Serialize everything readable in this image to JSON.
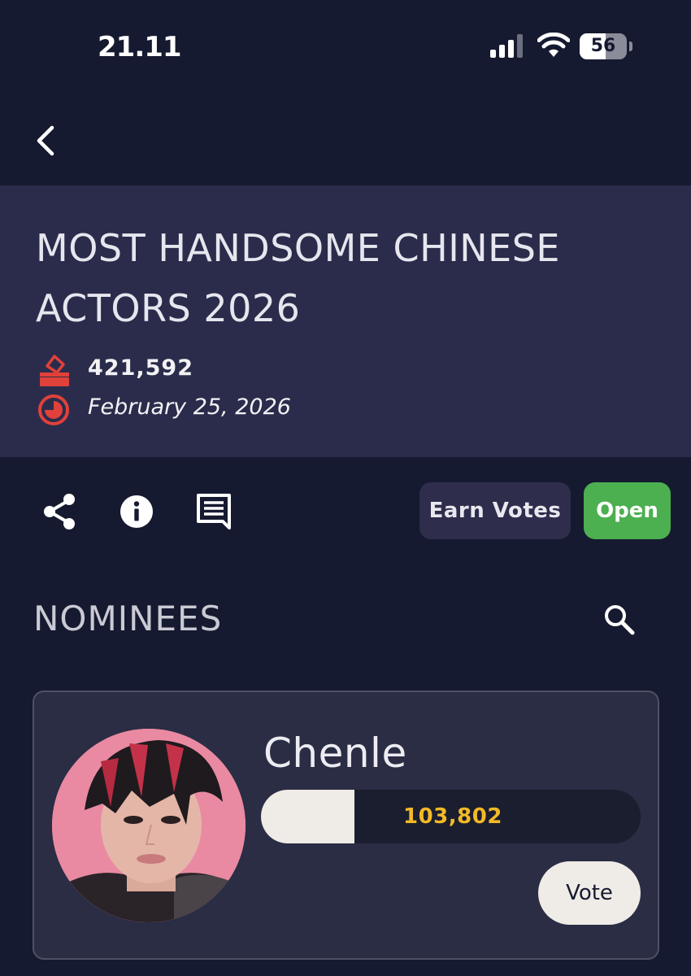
{
  "status_bar": {
    "time": "21.11",
    "battery_level": "56",
    "battery_fraction": 0.56
  },
  "header": {
    "title": "MOST HANDSOME CHINESE ACTORS 2026",
    "total_votes": "421,592",
    "end_date": "February 25, 2026"
  },
  "actions": {
    "earn_votes_label": "Earn Votes",
    "status_label": "Open"
  },
  "nominees": {
    "section_title": "NOMINEES",
    "items": [
      {
        "name": "Chenle",
        "votes": "103,802",
        "vote_share_fraction": 0.246,
        "vote_label": "Vote"
      }
    ]
  },
  "icons": {
    "back": "chevron-left-icon",
    "ballot": "ballot-box-icon",
    "clock": "clock-icon",
    "share": "share-icon",
    "info": "info-icon",
    "comment": "comment-icon",
    "search": "search-icon"
  },
  "colors": {
    "background": "#161a30",
    "header_panel": "#2b2c4b",
    "accent_red": "#e0413a",
    "open_green": "#4caf50",
    "vote_count_yellow": "#f3b927",
    "card_background": "#2a2d44"
  }
}
